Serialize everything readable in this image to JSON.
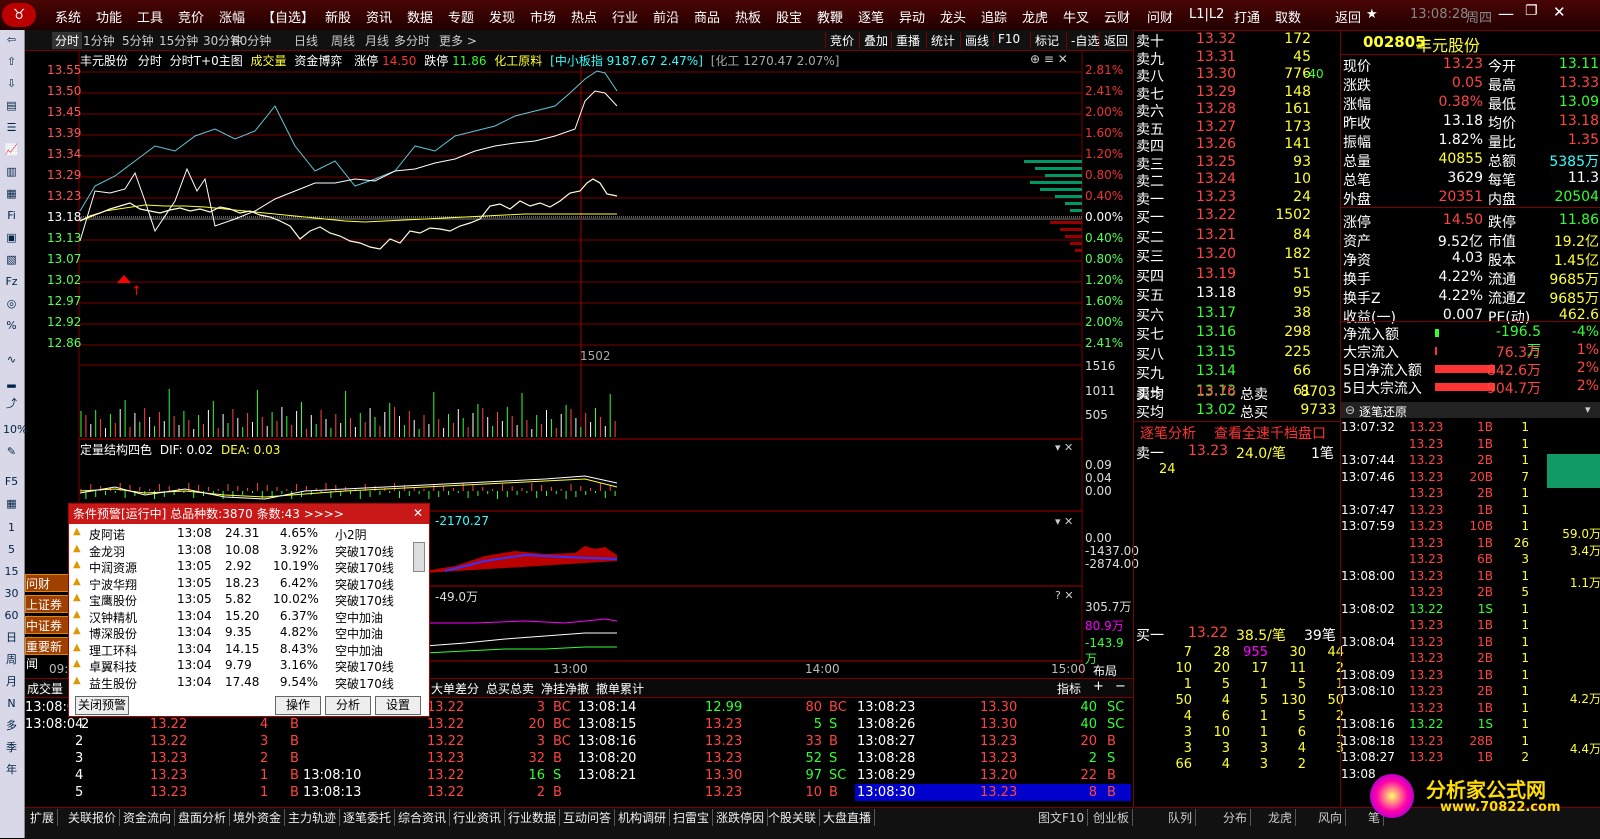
{
  "menu": {
    "items": [
      "系统",
      "功能",
      "工具",
      "竞价",
      "涨幅",
      "【自选】",
      "新股",
      "资讯",
      "数据",
      "专题",
      "发现",
      "市场",
      "热点",
      "行业",
      "前沿",
      "商品",
      "热板",
      "股宝",
      "教鞭",
      "逐笔",
      "异动",
      "龙头",
      "追踪",
      "龙虎",
      "牛叉",
      "云财",
      "问财",
      "L1|L2",
      "打通",
      "取数"
    ],
    "right": [
      "返回",
      "★",
      "13:08:28",
      "周四"
    ]
  },
  "period_tabs": [
    "分时",
    "1分钟",
    "5分钟",
    "15分钟",
    "30分钟",
    "60分钟",
    "日线",
    "周线",
    "月线",
    "多分时",
    "更多 >"
  ],
  "right_tools": [
    "竞价",
    "叠加",
    "重播",
    "统计",
    "画线",
    "F10",
    "标记",
    "-自选",
    "返回"
  ],
  "chart": {
    "header": {
      "stock": "丰元股份",
      "mode": "分时",
      "mode2": "分时T+0主图",
      "t1": "成交量",
      "t2": "资金博弈",
      "limitup_label": "涨停",
      "limitup": "14.50",
      "limitdown_label": "跌停",
      "limitdown": "11.86",
      "sector": "化工原料",
      "index": "[中小板指 9187.67 2.47%]",
      "index2": "[化工 1270.47 2.07%]"
    },
    "y_left": [
      "13.55",
      "13.50",
      "13.45",
      "13.39",
      "13.34",
      "13.29",
      "13.23",
      "13.18",
      "13.13",
      "13.07",
      "13.02",
      "12.97",
      "12.92",
      "12.86"
    ],
    "y_right": [
      "2.81%",
      "2.41%",
      "2.00%",
      "1.60%",
      "1.20%",
      "0.80%",
      "0.40%",
      "0.00%",
      "0.40%",
      "0.80%",
      "1.20%",
      "1.60%",
      "2.00%",
      "2.41%"
    ],
    "vol_right": [
      "1516",
      "1011",
      "505"
    ],
    "cursor_vol": "1502",
    "macd_label": "定量结构四色",
    "dif": "DIF: 0.02",
    "dea": "DEA: 0.03",
    "macd_right": [
      "0.09",
      "0.04",
      "0.00"
    ],
    "fund_label": "-2170.27",
    "fund_right": [
      "0.00",
      "-1437.00",
      "-2874.00"
    ],
    "flow_label": "-49.0万",
    "flow_right": [
      "305.7万",
      "80.9万",
      "-143.9万"
    ],
    "time_axis": [
      "09:30",
      "13:00",
      "14:00",
      "15:00"
    ],
    "layout_btn": "布局",
    "side_btns": [
      "问财",
      "上证券指",
      "中证券指",
      "重要新闻"
    ]
  },
  "orderbook": {
    "sells": [
      [
        "卖十",
        "13.32",
        "172"
      ],
      [
        "卖九",
        "13.31",
        "45"
      ],
      [
        "卖八",
        "13.30",
        "776"
      ],
      [
        "卖七",
        "13.29",
        "148"
      ],
      [
        "卖六",
        "13.28",
        "161"
      ],
      [
        "卖五",
        "13.27",
        "173"
      ],
      [
        "卖四",
        "13.26",
        "141"
      ],
      [
        "卖三",
        "13.25",
        "93"
      ],
      [
        "卖二",
        "13.24",
        "10"
      ],
      [
        "卖一",
        "13.23",
        "24"
      ]
    ],
    "buys": [
      [
        "买一",
        "13.22",
        "1502"
      ],
      [
        "买二",
        "13.21",
        "84"
      ],
      [
        "买三",
        "13.20",
        "182"
      ],
      [
        "买四",
        "13.19",
        "51"
      ],
      [
        "买五",
        "13.18",
        "95"
      ],
      [
        "买六",
        "13.17",
        "38"
      ],
      [
        "买七",
        "13.16",
        "298"
      ],
      [
        "买八",
        "13.15",
        "225"
      ],
      [
        "买九",
        "13.14",
        "66"
      ],
      [
        "买十",
        "13.13",
        "61"
      ]
    ],
    "sell_avg": [
      "卖均",
      "13.76",
      "总卖",
      "8703"
    ],
    "buy_avg": [
      "买均",
      "13.02",
      "总买",
      "9733"
    ],
    "change_8": "-40",
    "tab1": "逐笔分析",
    "tab2": "查看全速千档盘口",
    "s1": [
      "卖一",
      "13.23",
      "24.0/笔",
      "1笔"
    ],
    "s1q": "24",
    "b1": [
      "买一",
      "13.22",
      "38.5/笔",
      "39笔"
    ],
    "queue": [
      [
        "7",
        "28",
        "955",
        "30",
        "44"
      ],
      [
        "10",
        "20",
        "17",
        "11",
        "2"
      ],
      [
        "1",
        "5",
        "1",
        "5",
        "1"
      ],
      [
        "50",
        "4",
        "5",
        "130",
        "50"
      ],
      [
        "4",
        "6",
        "1",
        "5",
        "2"
      ],
      [
        "3",
        "10",
        "1",
        "6",
        "1"
      ],
      [
        "3",
        "3",
        "3",
        "4",
        "3"
      ],
      [
        "66",
        "4",
        "3",
        "2",
        ""
      ]
    ]
  },
  "quote": {
    "code": "002805",
    "name": "丰元股份",
    "rows": [
      [
        "现价",
        "13.23",
        "今开",
        "13.11"
      ],
      [
        "涨跌",
        "0.05",
        "最高",
        "13.33"
      ],
      [
        "涨幅",
        "0.38%",
        "最低",
        "13.09"
      ],
      [
        "昨收",
        "13.18",
        "均价",
        "13.18"
      ],
      [
        "振幅",
        "1.82%",
        "量比",
        "1.35"
      ],
      [
        "总量",
        "40855",
        "总额",
        "5385万"
      ],
      [
        "总笔",
        "3629",
        "每笔",
        "11.3"
      ],
      [
        "外盘",
        "20351",
        "内盘",
        "20504"
      ],
      [
        "涨停",
        "14.50",
        "跌停",
        "11.86"
      ],
      [
        "资产",
        "9.52亿",
        "市值",
        "19.2亿"
      ],
      [
        "净资",
        "4.03",
        "股本",
        "1.45亿"
      ],
      [
        "换手",
        "4.22%",
        "流通",
        "9685万"
      ],
      [
        "换手Z",
        "4.22%",
        "流通Z",
        "9685万"
      ],
      [
        "收益(一)",
        "0.007",
        "PE(动)",
        "462.6"
      ]
    ],
    "flows": [
      [
        "净流入额",
        "-196.5万",
        "-4%"
      ],
      [
        "大宗流入",
        "76.3万",
        "1%"
      ],
      [
        "5日净流入额",
        "842.6万",
        "2%"
      ],
      [
        "5日大宗流入",
        "904.7万",
        "2%"
      ]
    ]
  },
  "ticks": {
    "title": "逐笔还原",
    "rows": [
      [
        "13:07:32",
        "13.23",
        "1B",
        "1"
      ],
      [
        "",
        "13.23",
        "1B",
        "1"
      ],
      [
        "13:07:44",
        "13.23",
        "2B",
        "1"
      ],
      [
        "13:07:46",
        "13.23",
        "20B",
        "7"
      ],
      [
        "",
        "13.23",
        "2B",
        "1"
      ],
      [
        "13:07:47",
        "13.23",
        "1B",
        "1"
      ],
      [
        "13:07:59",
        "13.23",
        "10B",
        "1"
      ],
      [
        "",
        "13.23",
        "1B",
        "26"
      ],
      [
        "",
        "13.23",
        "6B",
        "3"
      ],
      [
        "13:08:00",
        "13.23",
        "1B",
        "1"
      ],
      [
        "",
        "13.23",
        "2B",
        "5"
      ],
      [
        "13:08:02",
        "13.22",
        "1S",
        "1"
      ],
      [
        "",
        "13.23",
        "1B",
        "1"
      ],
      [
        "13:08:04",
        "13.23",
        "1B",
        "1"
      ],
      [
        "",
        "13.23",
        "2B",
        "1"
      ],
      [
        "13:08:09",
        "13.23",
        "1B",
        "1"
      ],
      [
        "13:08:10",
        "13.23",
        "2B",
        "1"
      ],
      [
        "",
        "13.23",
        "1B",
        "1"
      ],
      [
        "13:08:16",
        "13.22",
        "1S",
        "1"
      ],
      [
        "13:08:18",
        "13.23",
        "28B",
        "1"
      ],
      [
        "13:08:27",
        "13.23",
        "1B",
        "2"
      ],
      [
        "13:08",
        "",
        "",
        ""
      ]
    ],
    "vols": [
      "446",
      "59.0万",
      "3.4万",
      "1.1万",
      "4.2万",
      "4.4万"
    ]
  },
  "alert": {
    "title": "条件预警[运行中] 总品种数:3870 条数:43  >>>>",
    "rows": [
      [
        "皮阿诺",
        "13:08",
        "24.31",
        "4.65%",
        "小2阴"
      ],
      [
        "金龙羽",
        "13:08",
        "10.08",
        "3.92%",
        "突破170线"
      ],
      [
        "中润资源",
        "13:05",
        "2.92",
        "10.19%",
        "突破170线"
      ],
      [
        "宁波华翔",
        "13:05",
        "18.23",
        "6.42%",
        "突破170线"
      ],
      [
        "宝鹰股份",
        "13:05",
        "5.82",
        "10.02%",
        "突破170线"
      ],
      [
        "汉钟精机",
        "13:04",
        "15.20",
        "6.37%",
        "空中加油"
      ],
      [
        "博深股份",
        "13:04",
        "9.35",
        "4.82%",
        "空中加油"
      ],
      [
        "理工环科",
        "13:04",
        "14.15",
        "8.43%",
        "空中加油"
      ],
      [
        "卓翼科技",
        "13:04",
        "9.79",
        "3.16%",
        "突破170线"
      ],
      [
        "益生股份",
        "13:04",
        "17.48",
        "9.54%",
        "突破170线"
      ]
    ],
    "buttons": [
      "关闭预警",
      "操作",
      "分析",
      "设置"
    ]
  },
  "bottom": {
    "tabs": [
      "成交量",
      "大单差分",
      "总买总卖",
      "净挂净撤",
      "撤单累计",
      "指标"
    ],
    "col1": [
      [
        "13:08:04",
        "",
        ""
      ],
      [
        "13:08:04",
        "2",
        ""
      ],
      [
        "",
        "2",
        ""
      ],
      [
        "",
        "3",
        ""
      ],
      [
        "",
        "4",
        ""
      ],
      [
        "",
        "5",
        ""
      ]
    ],
    "c1": [
      [
        "13.22",
        "4",
        "B"
      ],
      [
        "13.22",
        "3",
        "B"
      ],
      [
        "13.23",
        "2",
        "B"
      ],
      [
        "13.23",
        "1",
        "B"
      ],
      [
        "13.23",
        "1",
        "B"
      ]
    ],
    "c2": [
      [
        "13:08:09",
        "13.22",
        "3",
        "BC"
      ],
      [
        "",
        "13.22",
        "20",
        "BC"
      ],
      [
        "",
        "13.22",
        "3",
        "BC"
      ],
      [
        "",
        "13.23",
        "32",
        "B"
      ],
      [
        "13:08:10",
        "13.22",
        "16",
        "S"
      ],
      [
        "13:08:13",
        "13.22",
        "2",
        "B"
      ]
    ],
    "c2t": [
      "",
      "13:08:09",
      "",
      "",
      "13:08:10",
      "13:08:13"
    ],
    "c3": [
      [
        "13:08:14",
        "12.99",
        "80",
        "BC"
      ],
      [
        "13:08:15",
        "13.23",
        "5",
        "S"
      ],
      [
        "13:08:16",
        "13.23",
        "33",
        "B"
      ],
      [
        "13:08:20",
        "13.23",
        "52",
        "S"
      ],
      [
        "13:08:21",
        "13.30",
        "97",
        "SC"
      ],
      [
        "",
        "13.23",
        "10",
        "B"
      ]
    ],
    "c4": [
      [
        "13:08:23",
        "13.30",
        "40",
        "SC"
      ],
      [
        "13:08:26",
        "13.30",
        "40",
        "SC"
      ],
      [
        "13:08:27",
        "13.23",
        "20",
        "B"
      ],
      [
        "13:08:28",
        "13.23",
        "2",
        "S"
      ],
      [
        "13:08:29",
        "13.20",
        "22",
        "B"
      ],
      [
        "13:08:30",
        "13.23",
        "8",
        "B"
      ]
    ]
  },
  "botbar": [
    "扩展",
    "关联报价",
    "资金流向",
    "盘面分析",
    "境外资金",
    "主力轨迹",
    "逐笔委托",
    "综合资讯",
    "行业资讯",
    "行业数据",
    "互动问答",
    "机构调研",
    "扫雷宝",
    "涨跌停因",
    "个股关联",
    "大盘直播",
    "图文F10",
    "创业板",
    "队列",
    "分布",
    "龙虎",
    "风向",
    "笔"
  ],
  "watermark": {
    "name": "分析家公式网",
    "url": "www.70822.com"
  }
}
